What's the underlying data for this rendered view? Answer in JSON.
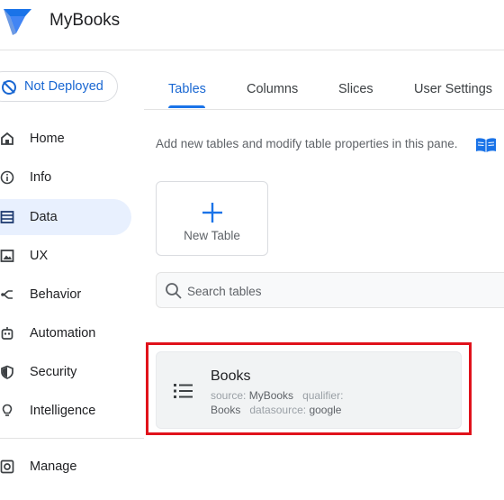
{
  "app": {
    "name": "MyBooks",
    "logo_icon": "appsheet-logo-icon"
  },
  "deploy": {
    "status": "Not Deployed",
    "icon": "not-deployed-icon"
  },
  "tabs": [
    {
      "label": "Tables",
      "active": true
    },
    {
      "label": "Columns",
      "active": false
    },
    {
      "label": "Slices",
      "active": false
    },
    {
      "label": "User Settings",
      "active": false
    }
  ],
  "sidebar": {
    "items": [
      {
        "label": "Home",
        "icon": "home-icon",
        "active": false
      },
      {
        "label": "Info",
        "icon": "info-icon",
        "active": false
      },
      {
        "label": "Data",
        "icon": "data-icon",
        "active": true
      },
      {
        "label": "UX",
        "icon": "ux-icon",
        "active": false
      },
      {
        "label": "Behavior",
        "icon": "behavior-icon",
        "active": false
      },
      {
        "label": "Automation",
        "icon": "automation-icon",
        "active": false
      },
      {
        "label": "Security",
        "icon": "security-icon",
        "active": false
      },
      {
        "label": "Intelligence",
        "icon": "intelligence-icon",
        "active": false
      },
      {
        "label": "Manage",
        "icon": "manage-icon",
        "active": false
      }
    ]
  },
  "main": {
    "hint": "Add new tables and modify table properties in this pane.",
    "new_table_label": "New Table",
    "search_placeholder": "Search tables",
    "tables": [
      {
        "name": "Books",
        "source_label": "source:",
        "source": "MyBooks",
        "qualifier_label": "qualifier:",
        "qualifier": "Books",
        "datasource_label": "datasource:",
        "datasource": "google"
      }
    ]
  },
  "colors": {
    "accent": "#1a73e8",
    "highlight": "#e0121b",
    "active_nav": "#e8f0fe"
  }
}
